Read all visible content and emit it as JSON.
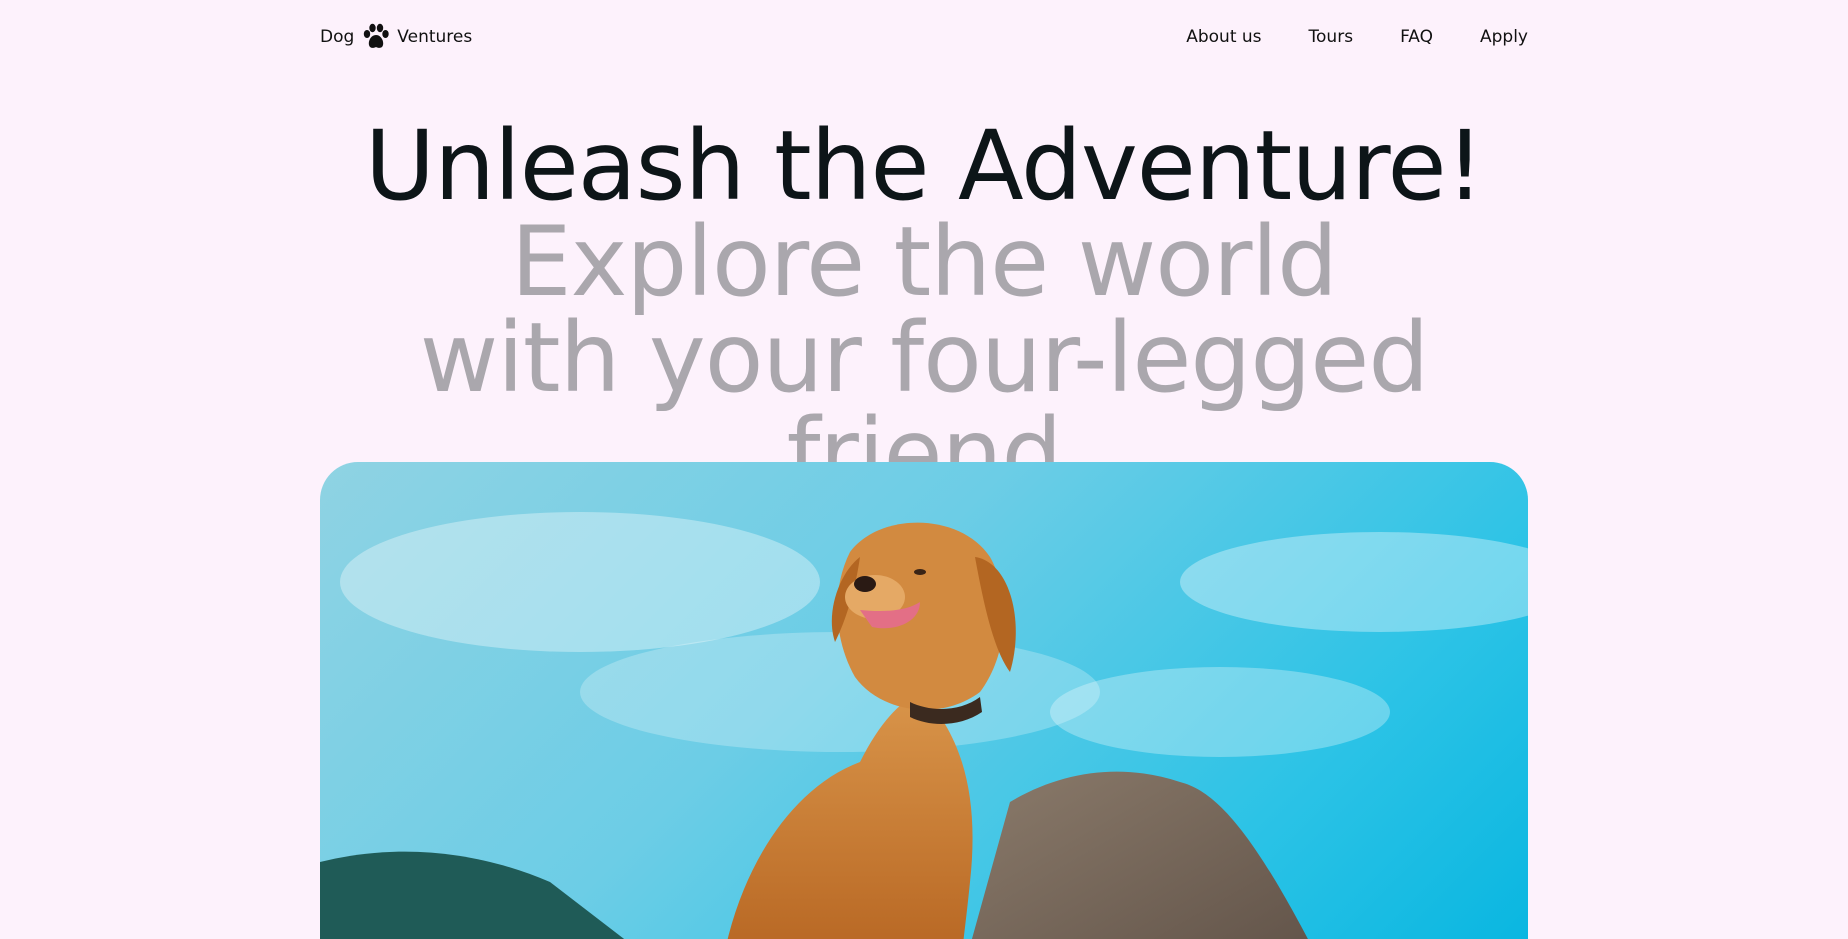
{
  "brand": {
    "name_left": "Dog",
    "name_right": "Ventures",
    "icon": "paw-icon"
  },
  "nav": {
    "items": [
      {
        "label": "About us"
      },
      {
        "label": "Tours"
      },
      {
        "label": "FAQ"
      },
      {
        "label": "Apply"
      }
    ]
  },
  "hero": {
    "headline": "Unleash the Adventure!",
    "subline": "Explore the world with your four-legged friend"
  },
  "colors": {
    "background": "#fdf2fc",
    "headline": "#0d1518",
    "subline": "#aaa7ad",
    "sky": "#2cc3e6"
  }
}
